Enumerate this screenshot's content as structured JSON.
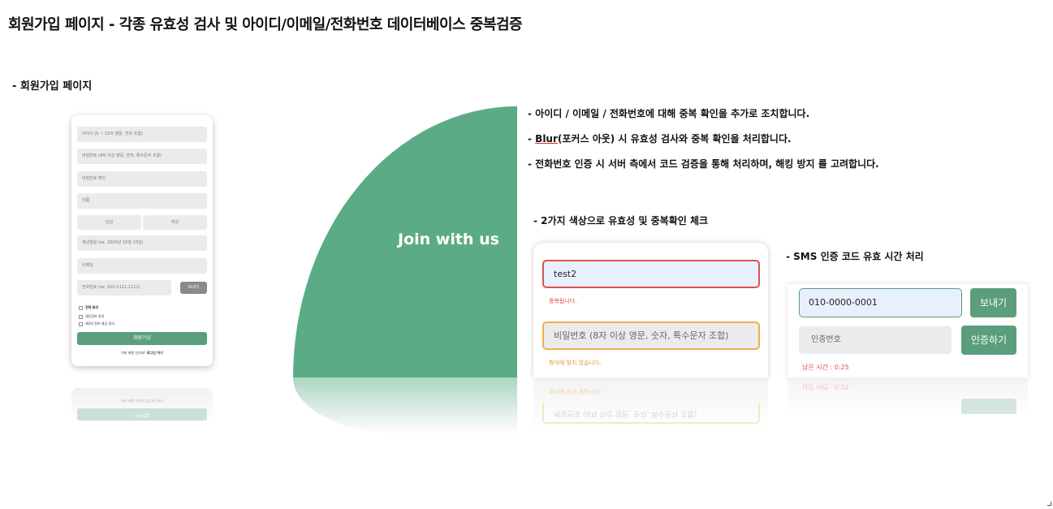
{
  "title": "회원가입 페이지 - 각종 유효성 검사 및 아이디/이메일/전화번호 데이터베이스 중복검증",
  "section_label": "- 회원가입 페이지",
  "signup_form": {
    "fields": [
      "아이디 (5 ~ 15자 영문, 숫자 조합)",
      "비밀번호 (8자 이상 영문, 숫자, 특수문자 조합)",
      "비밀번호 확인",
      "이름",
      "생년월일 (ex. 2000년 10월 10일)",
      "이메일",
      "전화번호 (ex. 010-1111-1111)"
    ],
    "gender": [
      "남성",
      "여성"
    ],
    "send_button": "보내기",
    "agreements": [
      "전체 동의",
      "개인정보 동의",
      "제3자 정보 제공 동의"
    ],
    "join_button": "회원가입",
    "login_prompt": "이미 회원 인가요?",
    "login_link": "로그인 하기"
  },
  "hero_text": "Join with us",
  "bullets": [
    "- 아이디 / 이메일 / 전화번호에 대해 중복 확인을 추가로 조치합니다.",
    "(포커스 아웃) 시 유효성 검사와 중복 확인을 처리합니다.",
    "- 전화번호 인증 시 서버 측에서 코드 검증을 통해 처리하며, 해킹 방지 를 고려합니다."
  ],
  "blur_prefix": "- ",
  "blur_word": "Blur",
  "validation_label": "- 2가지 색상으로 유효성 및 중복확인 체크",
  "validation": {
    "id_value": "test2",
    "id_msg": "중복됩니다.",
    "pw_placeholder": "비밀번호 (8자 이상 영문, 숫자, 특수문자 조합)",
    "pw_msg": "형식에 맞지 않습니다.",
    "error_color": "#d9534f",
    "warning_color": "#f0ad4e"
  },
  "sms_label": "- SMS 인증 코드 유효 시간 처리",
  "sms": {
    "phone_value": "010-0000-0001",
    "send_button": "보내기",
    "code_placeholder": "인증번호",
    "verify_button": "인증하기",
    "timer": "남은 시간 : 0:25"
  },
  "accent_color": "#5cab87"
}
